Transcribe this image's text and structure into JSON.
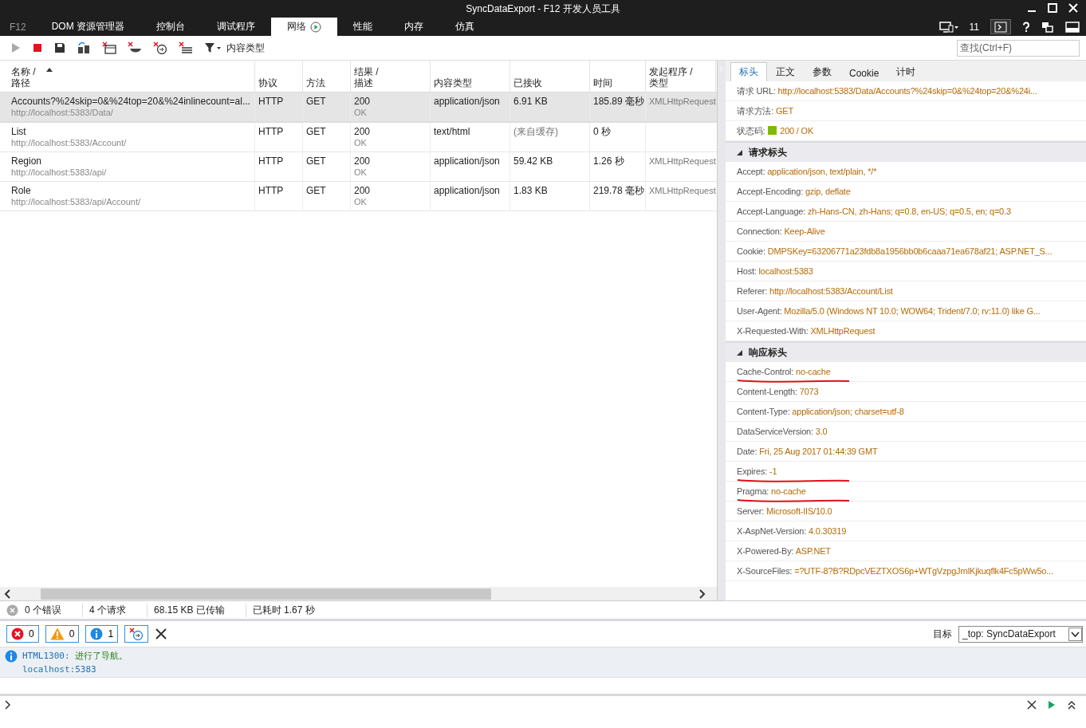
{
  "window": {
    "title": "SyncDataExport - F12 开发人员工具"
  },
  "f12_label": "F12",
  "tabs": [
    {
      "label": "DOM 资源管理器",
      "selected": false,
      "recording": false
    },
    {
      "label": "控制台",
      "selected": false,
      "recording": false
    },
    {
      "label": "调试程序",
      "selected": false,
      "recording": false
    },
    {
      "label": "网络",
      "selected": true,
      "recording": true
    },
    {
      "label": "性能",
      "selected": false,
      "recording": false
    },
    {
      "label": "内存",
      "selected": false,
      "recording": false
    },
    {
      "label": "仿真",
      "selected": false,
      "recording": false
    }
  ],
  "browser_version": "11",
  "toolbar": {
    "filter_label": "内容类型",
    "search": {
      "placeholder": "查找(Ctrl+F)"
    }
  },
  "table": {
    "columns": [
      {
        "label": "名称 /",
        "sublabel": "路径",
        "sorted": true
      },
      {
        "label": "协议",
        "sorted": false
      },
      {
        "label": "方法",
        "sorted": false
      },
      {
        "label": "结果 /",
        "sublabel": "描述",
        "sorted": false
      },
      {
        "label": "内容类型",
        "sorted": false
      },
      {
        "label": "已接收",
        "sorted": false
      },
      {
        "label": "时间",
        "sorted": false
      },
      {
        "label": "发起程序 /",
        "sublabel": "类型",
        "sorted": false
      }
    ],
    "rows": [
      {
        "name": "Accounts?%24skip=0&%24top=20&%24inlinecount=al...",
        "path": "http://localhost:5383/Data/",
        "protocol": "HTTP",
        "method": "GET",
        "status": "200",
        "status_text": "OK",
        "type": "application/json",
        "received": "6.91 KB",
        "cached": false,
        "time": "185.89 毫秒",
        "initiator": "XMLHttpRequest",
        "selected": true
      },
      {
        "name": "List",
        "path": "http://localhost:5383/Account/",
        "protocol": "HTTP",
        "method": "GET",
        "status": "200",
        "status_text": "OK",
        "type": "text/html",
        "received": "(来自缓存)",
        "cached": true,
        "time": "0 秒",
        "selected": false
      },
      {
        "name": "Region",
        "path": "http://localhost:5383/api/",
        "protocol": "HTTP",
        "method": "GET",
        "status": "200",
        "status_text": "OK",
        "type": "application/json",
        "received": "59.42 KB",
        "cached": false,
        "time": "1.26 秒",
        "initiator": "XMLHttpRequest",
        "selected": false
      },
      {
        "name": "Role",
        "path": "http://localhost:5383/api/Account/",
        "protocol": "HTTP",
        "method": "GET",
        "status": "200",
        "status_text": "OK",
        "type": "application/json",
        "received": "1.83 KB",
        "cached": false,
        "time": "219.78 毫秒",
        "initiator": "XMLHttpRequest",
        "selected": false
      }
    ]
  },
  "status_bar": {
    "errors": "0 个错误",
    "requests": "4 个请求",
    "transferred": "68.15 KB 已传输",
    "elapsed": "已耗时 1.67 秒"
  },
  "details": {
    "tabs": [
      {
        "label": "标头",
        "selected": true
      },
      {
        "label": "正文",
        "selected": false
      },
      {
        "label": "参数",
        "selected": false
      },
      {
        "label": "Cookie",
        "selected": false
      },
      {
        "label": "计时",
        "selected": false
      }
    ],
    "general": [
      {
        "name": "请求 URL:",
        "value": "http://localhost:5383/Data/Accounts?%24skip=0&%24top=20&%24i..."
      },
      {
        "name": "请求方法:",
        "value": "GET"
      },
      {
        "name": "状态码:",
        "value": "200 / OK",
        "color": "#7fba00"
      }
    ],
    "sections": [
      {
        "title": "请求标头",
        "expanded": true,
        "rows": [
          {
            "name": "Accept:",
            "value": "application/json, text/plain, */*",
            "underlined": false
          },
          {
            "name": "Accept-Encoding:",
            "value": "gzip, deflate",
            "underlined": false
          },
          {
            "name": "Accept-Language:",
            "value": "zh-Hans-CN, zh-Hans; q=0.8, en-US; q=0.5, en; q=0.3",
            "underlined": false
          },
          {
            "name": "Connection:",
            "value": "Keep-Alive",
            "underlined": false
          },
          {
            "name": "Cookie:",
            "value": "DMPSKey=63206771a23fdb8a1956bb0b6caaa71ea678af21; ASP.NET_S...",
            "underlined": false
          },
          {
            "name": "Host:",
            "value": "localhost:5383",
            "underlined": false
          },
          {
            "name": "Referer:",
            "value": "http://localhost:5383/Account/List",
            "underlined": false
          },
          {
            "name": "User-Agent:",
            "value": "Mozilla/5.0 (Windows NT 10.0; WOW64; Trident/7.0; rv:11.0) like G...",
            "underlined": false
          },
          {
            "name": "X-Requested-With:",
            "value": "XMLHttpRequest",
            "underlined": false
          }
        ]
      },
      {
        "title": "响应标头",
        "expanded": true,
        "rows": [
          {
            "name": "Cache-Control:",
            "value": "no-cache",
            "underlined": true
          },
          {
            "name": "Content-Length:",
            "value": "7073",
            "underlined": false
          },
          {
            "name": "Content-Type:",
            "value": "application/json; charset=utf-8",
            "underlined": false
          },
          {
            "name": "DataServiceVersion:",
            "value": "3.0",
            "underlined": false
          },
          {
            "name": "Date:",
            "value": "Fri, 25 Aug 2017 01:44:39 GMT",
            "underlined": false
          },
          {
            "name": "Expires:",
            "value": "-1",
            "underlined": true
          },
          {
            "name": "Pragma:",
            "value": "no-cache",
            "underlined": true
          },
          {
            "name": "Server:",
            "value": "Microsoft-IIS/10.0",
            "underlined": false
          },
          {
            "name": "X-AspNet-Version:",
            "value": "4.0.30319",
            "underlined": false
          },
          {
            "name": "X-Powered-By:",
            "value": "ASP.NET",
            "underlined": false
          },
          {
            "name": "X-SourceFiles:",
            "value": "=?UTF-8?B?RDpcVEZTXOS6p+WTgVzpgJrnlKjkuqflk4Fc5pWw5o...",
            "underlined": false
          }
        ]
      }
    ]
  },
  "console": {
    "filters": [
      {
        "kind": "error",
        "count": "0"
      },
      {
        "kind": "warning",
        "count": "0"
      },
      {
        "kind": "info",
        "count": "1"
      }
    ],
    "target_label": "目标",
    "target_value": "_top: SyncDataExport",
    "messages": [
      {
        "kind": "info",
        "code": "HTML1300:",
        "text": "进行了导航。",
        "source": "localhost:5383"
      }
    ]
  }
}
